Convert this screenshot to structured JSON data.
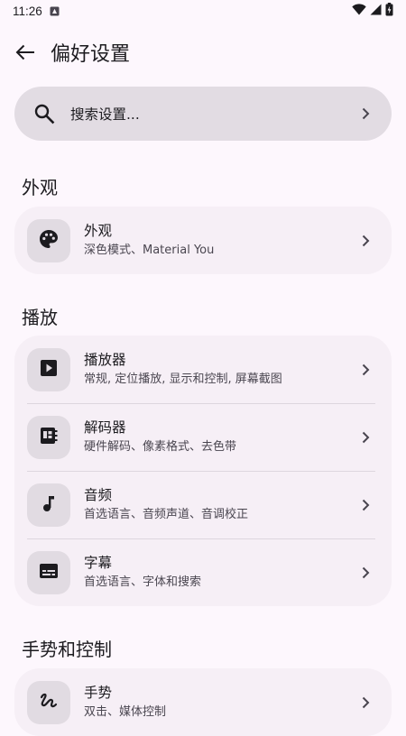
{
  "status_bar": {
    "time": "11:26"
  },
  "app_bar": {
    "title": "偏好设置"
  },
  "search": {
    "placeholder": "搜索设置..."
  },
  "sections": [
    {
      "title": "外观",
      "items": [
        {
          "title": "外观",
          "subtitle": "深色模式、Material You",
          "icon": "palette-icon"
        }
      ]
    },
    {
      "title": "播放",
      "items": [
        {
          "title": "播放器",
          "subtitle": "常规, 定位播放, 显示和控制, 屏幕截图",
          "icon": "play-icon"
        },
        {
          "title": "解码器",
          "subtitle": "硬件解码、像素格式、去色带",
          "icon": "decoder-icon"
        },
        {
          "title": "音频",
          "subtitle": "首选语言、音频声道、音调校正",
          "icon": "music-note-icon"
        },
        {
          "title": "字幕",
          "subtitle": "首选语言、字体和搜索",
          "icon": "subtitles-icon"
        }
      ]
    },
    {
      "title": "手势和控制",
      "items": [
        {
          "title": "手势",
          "subtitle": "双击、媒体控制",
          "icon": "gesture-icon"
        }
      ]
    }
  ],
  "colors": {
    "background": "#FDF7FD",
    "search_bg": "#E2DCE3",
    "card_bg": "#F6EFF6",
    "icon_tile_bg": "#E1DBE2",
    "text": "#1C1B1F"
  }
}
